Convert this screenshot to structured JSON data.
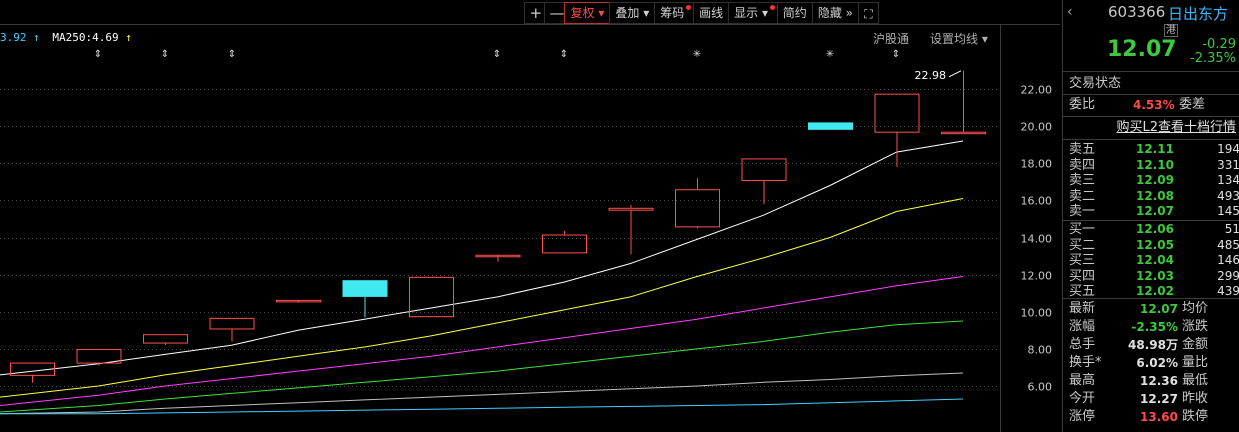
{
  "toolbar": {
    "plus": "+",
    "minus": "—",
    "fuquan": "复权",
    "diejia": "叠加",
    "chouma": "筹码",
    "huaxian": "画线",
    "xianshi": "显示",
    "jianyue": "简约",
    "yincang": "隐藏",
    "more_icon": "double-right-arrow",
    "fullscreen_icon": "fullscreen"
  },
  "ma_readout": {
    "prev_value": "3.92",
    "ma250_label": "MA250:4.69"
  },
  "links": {
    "index": "沪股通",
    "set_ma": "设置均线"
  },
  "chart_data": {
    "type": "candlestick",
    "y_ticks": [
      "22.00",
      "20.00",
      "18.00",
      "16.00",
      "14.00",
      "12.00",
      "10.00",
      "8.00",
      "6.00"
    ],
    "ylim": [
      4.5,
      23.5
    ],
    "high_annotation": "22.98",
    "candles": [
      {
        "o": 6.6,
        "c": 7.26,
        "h": 7.26,
        "l": 6.18,
        "type": "up"
      },
      {
        "o": 7.26,
        "c": 7.99,
        "h": 7.99,
        "l": 7.1,
        "type": "up"
      },
      {
        "o": 8.34,
        "c": 8.79,
        "h": 8.79,
        "l": 8.2,
        "type": "up"
      },
      {
        "o": 9.1,
        "c": 9.67,
        "h": 9.67,
        "l": 8.4,
        "type": "up"
      },
      {
        "o": 10.6,
        "c": 10.64,
        "h": 10.64,
        "l": 10.5,
        "type": "up"
      },
      {
        "o": 11.7,
        "c": 10.8,
        "h": 11.7,
        "l": 9.7,
        "type": "down"
      },
      {
        "o": 9.76,
        "c": 11.88,
        "h": 11.88,
        "l": 9.76,
        "type": "up"
      },
      {
        "o": 13.07,
        "c": 13.07,
        "h": 13.07,
        "l": 12.7,
        "type": "up"
      },
      {
        "o": 13.2,
        "c": 14.16,
        "h": 14.36,
        "l": 13.2,
        "type": "up"
      },
      {
        "o": 15.5,
        "c": 15.6,
        "h": 15.75,
        "l": 13.1,
        "type": "up"
      },
      {
        "o": 14.6,
        "c": 16.6,
        "h": 17.2,
        "l": 14.5,
        "type": "up"
      },
      {
        "o": 17.1,
        "c": 18.26,
        "h": 18.26,
        "l": 15.8,
        "type": "up"
      },
      {
        "o": 20.2,
        "c": 19.8,
        "h": 20.2,
        "l": 19.8,
        "type": "down"
      },
      {
        "o": 19.7,
        "c": 21.75,
        "h": 21.75,
        "l": 17.8,
        "type": "up"
      },
      {
        "o": 19.7,
        "c": 19.7,
        "h": 22.98,
        "l": 19.7,
        "type": "up"
      }
    ],
    "ma_lines": [
      {
        "color": "#ffffff",
        "values": [
          6.6,
          7.2,
          7.7,
          8.2,
          9.0,
          9.6,
          10.2,
          10.8,
          11.6,
          12.6,
          13.9,
          15.2,
          16.8,
          18.6,
          19.2
        ]
      },
      {
        "color": "#ffff40",
        "values": [
          5.4,
          6.0,
          6.6,
          7.1,
          7.6,
          8.1,
          8.7,
          9.4,
          10.1,
          10.8,
          11.9,
          12.9,
          14.0,
          15.4,
          16.1
        ]
      },
      {
        "color": "#ff40ff",
        "values": [
          4.95,
          5.5,
          6.0,
          6.4,
          6.8,
          7.2,
          7.6,
          8.1,
          8.6,
          9.1,
          9.6,
          10.2,
          10.8,
          11.4,
          11.9
        ]
      },
      {
        "color": "#40e040",
        "values": [
          4.6,
          4.95,
          5.3,
          5.6,
          5.9,
          6.2,
          6.5,
          6.8,
          7.2,
          7.6,
          8.0,
          8.4,
          8.9,
          9.3,
          9.5
        ]
      },
      {
        "color": "#c0c0c0",
        "values": [
          4.5,
          4.6,
          4.8,
          4.95,
          5.1,
          5.25,
          5.4,
          5.55,
          5.7,
          5.85,
          6.0,
          6.2,
          6.35,
          6.55,
          6.7
        ]
      },
      {
        "color": "#40d0ff",
        "values": [
          4.5,
          4.5,
          4.55,
          4.6,
          4.65,
          4.7,
          4.75,
          4.8,
          4.85,
          4.9,
          4.95,
          5.0,
          5.1,
          5.2,
          5.3
        ]
      }
    ],
    "event_markers": [
      "⇕",
      "⇕",
      "⇕",
      "⇕",
      "⇕",
      "⇕",
      "✳",
      "⇕",
      "⇕"
    ]
  },
  "quote": {
    "code": "603366",
    "name": "日出东方",
    "hk_badge": "港",
    "price": "12.07",
    "change": "-0.29",
    "change_pct": "-2.35%",
    "status_label": "交易状态",
    "wei_bi_label": "委比",
    "wei_bi": "4.53%",
    "wei_cha_label": "委差",
    "l2_link": "购买L2查看十档行情"
  },
  "order_book": {
    "asks": [
      {
        "label": "卖五",
        "price": "12.11",
        "vol": "194"
      },
      {
        "label": "卖四",
        "price": "12.10",
        "vol": "331"
      },
      {
        "label": "卖三",
        "price": "12.09",
        "vol": "134"
      },
      {
        "label": "卖二",
        "price": "12.08",
        "vol": "493"
      },
      {
        "label": "卖一",
        "price": "12.07",
        "vol": "145"
      }
    ],
    "bids": [
      {
        "label": "买一",
        "price": "12.06",
        "vol": "51"
      },
      {
        "label": "买二",
        "price": "12.05",
        "vol": "485"
      },
      {
        "label": "买三",
        "price": "12.04",
        "vol": "146"
      },
      {
        "label": "买四",
        "price": "12.03",
        "vol": "299"
      },
      {
        "label": "买五",
        "price": "12.02",
        "vol": "439"
      }
    ]
  },
  "stats": [
    {
      "l1": "最新",
      "v1": "12.07",
      "c1": "green",
      "l2": "均价"
    },
    {
      "l1": "涨幅",
      "v1": "-2.35%",
      "c1": "green",
      "l2": "涨跌"
    },
    {
      "l1": "总手",
      "v1": "48.98万",
      "c1": "white",
      "l2": "金额"
    },
    {
      "l1": "换手*",
      "v1": "6.02%",
      "c1": "white",
      "l2": "量比"
    },
    {
      "l1": "最高",
      "v1": "12.36",
      "c1": "white",
      "l2": "最低"
    },
    {
      "l1": "今开",
      "v1": "12.27",
      "c1": "white",
      "l2": "昨收"
    },
    {
      "l1": "涨停",
      "v1": "13.60",
      "c1": "red",
      "l2": "跌停"
    }
  ]
}
